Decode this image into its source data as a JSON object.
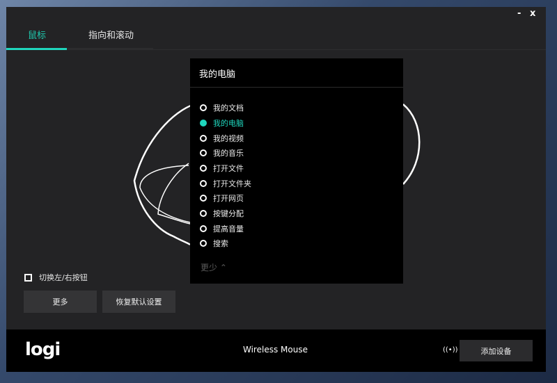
{
  "window": {
    "minimize": "-",
    "close": "x"
  },
  "tabs": [
    {
      "label": "鼠标",
      "active": true
    },
    {
      "label": "指向和滚动",
      "active": false
    }
  ],
  "dropdown": {
    "title": "我的电脑",
    "options": [
      "我的文档",
      "我的电脑",
      "我的视频",
      "我的音乐",
      "打开文件",
      "打开文件夹",
      "打开网页",
      "按键分配",
      "提高音量",
      "搜索"
    ],
    "selected_index": 1,
    "less_label": "更少 ⌃"
  },
  "swap_buttons": {
    "label": "切换左/右按钮",
    "checked": false
  },
  "buttons": {
    "more": "更多",
    "restore": "恢复默认设置"
  },
  "footer": {
    "logo": "logi",
    "device": "Wireless Mouse",
    "signal_icon": "((•))",
    "add_device": "添加设备"
  },
  "colors": {
    "accent": "#1fd6bd"
  }
}
